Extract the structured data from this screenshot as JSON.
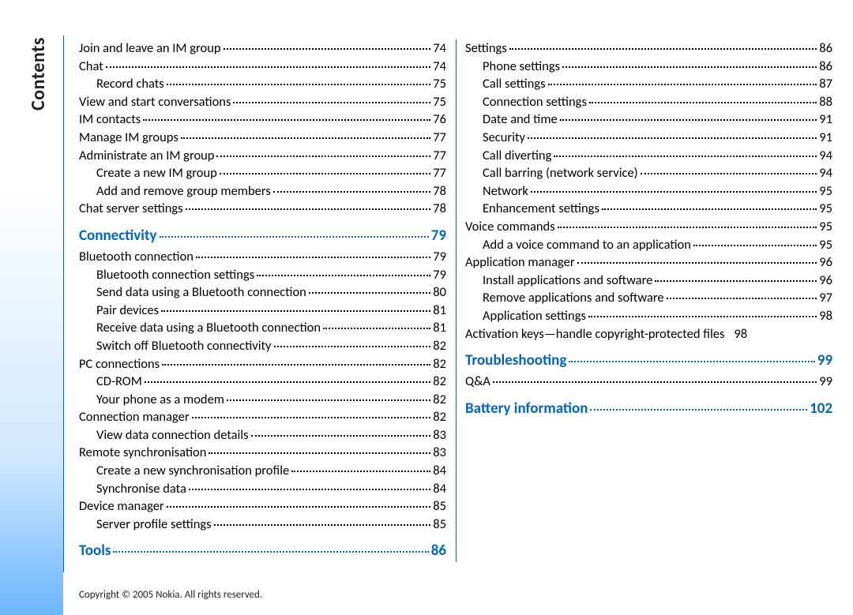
{
  "sidebar_label": "Contents",
  "footer": "Copyright © 2005 Nokia. All rights reserved.",
  "toc": [
    {
      "label": "Join and leave an IM group",
      "page": "74",
      "level": 0
    },
    {
      "label": "Chat",
      "page": "74",
      "level": 0
    },
    {
      "label": "Record chats",
      "page": "75",
      "level": 1
    },
    {
      "label": "View and start conversations",
      "page": "75",
      "level": 0
    },
    {
      "label": "IM contacts",
      "page": "76",
      "level": 0
    },
    {
      "label": "Manage IM groups",
      "page": "77",
      "level": 0
    },
    {
      "label": "Administrate an IM group",
      "page": "77",
      "level": 0
    },
    {
      "label": "Create a new IM group",
      "page": "77",
      "level": 1
    },
    {
      "label": "Add and remove group members",
      "page": "78",
      "level": 1
    },
    {
      "label": "Chat server settings",
      "page": "78",
      "level": 0
    },
    {
      "label": "Connectivity",
      "page": "79",
      "level": 0,
      "chapter": true
    },
    {
      "label": "Bluetooth connection",
      "page": "79",
      "level": 0
    },
    {
      "label": "Bluetooth connection settings",
      "page": "79",
      "level": 1
    },
    {
      "label": "Send data using a Bluetooth connection",
      "page": "80",
      "level": 1
    },
    {
      "label": "Pair devices",
      "page": "81",
      "level": 1
    },
    {
      "label": "Receive data using a Bluetooth connection",
      "page": "81",
      "level": 1
    },
    {
      "label": "Switch off Bluetooth connectivity",
      "page": "82",
      "level": 1
    },
    {
      "label": "PC connections",
      "page": "82",
      "level": 0
    },
    {
      "label": "CD-ROM",
      "page": "82",
      "level": 1
    },
    {
      "label": "Your phone as a modem",
      "page": "82",
      "level": 1
    },
    {
      "label": "Connection manager",
      "page": "82",
      "level": 0
    },
    {
      "label": "View data connection details",
      "page": "83",
      "level": 1
    },
    {
      "label": "Remote synchronisation",
      "page": "83",
      "level": 0
    },
    {
      "label": "Create a new synchronisation profile",
      "page": "84",
      "level": 1
    },
    {
      "label": "Synchronise data",
      "page": "84",
      "level": 1
    },
    {
      "label": "Device manager",
      "page": "85",
      "level": 0
    },
    {
      "label": "Server profile settings",
      "page": "85",
      "level": 1
    },
    {
      "label": "Tools",
      "page": "86",
      "level": 0,
      "chapter": true
    },
    {
      "label": "Settings",
      "page": "86",
      "level": 0
    },
    {
      "label": "Phone settings",
      "page": "86",
      "level": 1
    },
    {
      "label": "Call settings",
      "page": "87",
      "level": 1
    },
    {
      "label": "Connection settings",
      "page": "88",
      "level": 1
    },
    {
      "label": "Date and time",
      "page": "91",
      "level": 1
    },
    {
      "label": "Security",
      "page": "91",
      "level": 1
    },
    {
      "label": "Call diverting",
      "page": "94",
      "level": 1
    },
    {
      "label": "Call barring (network service)",
      "page": "94",
      "level": 1
    },
    {
      "label": "Network",
      "page": "95",
      "level": 1
    },
    {
      "label": "Enhancement settings",
      "page": "95",
      "level": 1
    },
    {
      "label": "Voice commands",
      "page": "95",
      "level": 0
    },
    {
      "label": "Add a voice command to an application",
      "page": "95",
      "level": 1
    },
    {
      "label": "Application manager",
      "page": "96",
      "level": 0
    },
    {
      "label": "Install applications and software",
      "page": "96",
      "level": 1
    },
    {
      "label": "Remove applications and software",
      "page": "97",
      "level": 1
    },
    {
      "label": "Application settings",
      "page": "98",
      "level": 1
    },
    {
      "label": "Activation keys—handle copyright-protected files",
      "page": "98",
      "level": 0,
      "tight": true
    },
    {
      "label": "Troubleshooting",
      "page": "99",
      "level": 0,
      "chapter": true
    },
    {
      "label": "Q&A",
      "page": "99",
      "level": 0
    },
    {
      "label": "Battery information",
      "page": "102",
      "level": 0,
      "chapter": true
    }
  ]
}
